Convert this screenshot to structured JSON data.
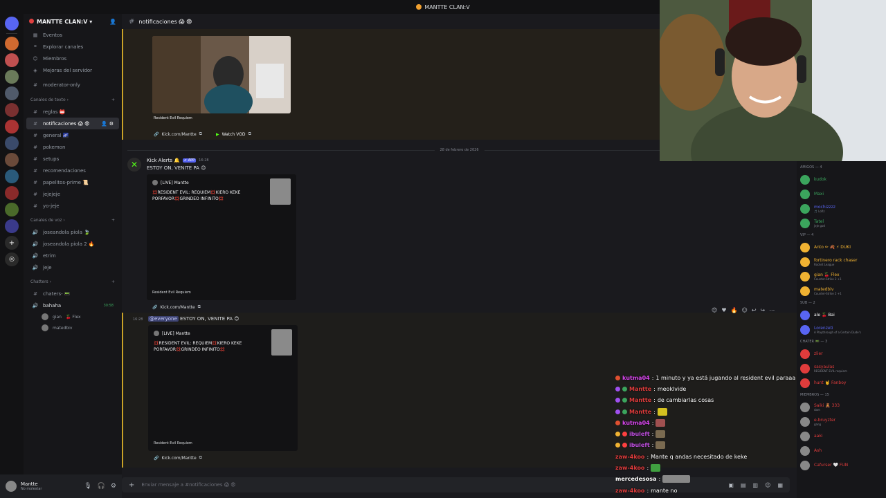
{
  "window": {
    "title": "MANTTE CLAN:V"
  },
  "server": {
    "name": "MANTTE CLAN:V"
  },
  "sidebar": {
    "top_items": [
      {
        "icon": "calendar-icon",
        "label": "Eventos"
      },
      {
        "icon": "compass-icon",
        "label": "Explorar canales"
      },
      {
        "icon": "members-icon",
        "label": "Miembros"
      },
      {
        "icon": "boost-icon",
        "label": "Mejoras del servidor"
      }
    ],
    "moderator_channel": "moderator-only",
    "text_category": "Canales de texto",
    "text_channels": [
      "reglas 📛",
      "notificaciones 😱 😨",
      "general 🌌",
      "pokemon",
      "setups",
      "recomendaciones",
      "papelitos-prime 📜",
      "jejejeje",
      "yo-jeje"
    ],
    "voice_category": "Canales de voz",
    "voice_channels": [
      "joseandola piola 🍃",
      "joseandola piola 2 🔥",
      "etrim",
      "jeje"
    ],
    "chatters_category": "Chatters",
    "chatters_channel": "chaters- 📟",
    "bahaha_channel": "bahaha",
    "bahaha_time": "30:58",
    "voice_users": [
      {
        "name": "gian",
        "tag": "🍒 Flex"
      },
      {
        "name": "matedbiv",
        "tag": ""
      }
    ]
  },
  "user_panel": {
    "name": "Mantte",
    "status": "No molestar"
  },
  "channel_header": {
    "name": "notificaciones 😱 😨"
  },
  "messages": {
    "top_embed_footer": "Resident Evil Requiem",
    "top_link": "Kick.com/Mantte",
    "watch_vod": "Watch VOD",
    "date_divider": "28 de febrero de 2026",
    "bot_name": "Kick Alerts 🔔",
    "app_badge": "✔ APP",
    "bot_time": "16:28",
    "msg1_text": "ESTOY ON, VENITE PA 😊",
    "embed_title": "[LIVE] Mantte",
    "embed_desc": "💢RESIDENT EVIL: REQUIEM💢KIERO KEKE PORFAVOR💢GRINDEO INFINITO💢",
    "embed_footer": "Resident Evil Requiem",
    "link_label": "Kick.com/Mantte",
    "msg2_time": "16:28",
    "mention": "@everyone",
    "msg2_text": " ESTOY ON, VENITE PA 😊"
  },
  "composer": {
    "placeholder": "Enviar mensaje a #notificaciones 😱 😨"
  },
  "members": {
    "cat_amigos": "AMIGOS — 4",
    "amigos": [
      {
        "name": "kudok",
        "activity": "",
        "color": "#3ba55d"
      },
      {
        "name": "Maxi",
        "activity": "",
        "color": "#3ba55d"
      },
      {
        "name": "mochizzzz",
        "activity": "🎵 Lofiz",
        "color": "#5865f2"
      },
      {
        "name": "Tatel",
        "activity": "jeje god",
        "color": "#3ba55d"
      }
    ],
    "cat_vip": "VIP — 4",
    "vip": [
      {
        "name": "Anto ✏ 🍂 ⚡ DUKI",
        "activity": "",
        "color": "#f0b232"
      },
      {
        "name": "fortinero rack chaser",
        "activity": "Rocket League",
        "color": "#f0b232"
      },
      {
        "name": "gian 🍒 Flex",
        "activity": "Counter-Strike 2 +1",
        "color": "#f0b232"
      },
      {
        "name": "matedbiv",
        "activity": "Counter-Strike 2 +1",
        "color": "#f0b232"
      }
    ],
    "cat_sub": "SUB — 2",
    "sub": [
      {
        "name": "ale 🍒 Bai",
        "activity": "",
        "color": "#ffffff"
      },
      {
        "name": "Lorenzeti",
        "activity": "A Playthrough of a Certain Dude's",
        "color": "#5865f2"
      }
    ],
    "cat_chater": "CHATER 📟 — 3",
    "chater": [
      {
        "name": "zlier",
        "activity": "",
        "color": "#e03c3c"
      },
      {
        "name": "sasyaulas",
        "activity": "RESIDENT EVIL requiem",
        "color": "#e03c3c"
      },
      {
        "name": "hunt 🤘 Fanboy",
        "activity": "",
        "color": "#e03c3c"
      }
    ],
    "cat_miembros": "MIEMBROS — 15",
    "miembros": [
      {
        "name": "Saiki 🧸 333",
        "activity": "dam",
        "color": "#e03c3c"
      },
      {
        "name": "e-bruyzter",
        "activity": "gang",
        "color": "#e03c3c"
      },
      {
        "name": "aaki",
        "activity": "",
        "color": "#e03c3c"
      },
      {
        "name": "Ash",
        "activity": "",
        "color": "#e03c3c"
      },
      {
        "name": "Cafurser 🤍 FUN",
        "activity": "",
        "color": "#e03c3c"
      }
    ]
  },
  "chat_overlay": [
    {
      "user": "kutma04",
      "user_color": "#d946ef",
      "text": "1 minuto y ya está jugando al resident evil paraaa",
      "badges": [
        "#e05030"
      ],
      "emote": ""
    },
    {
      "user": "Mantte",
      "user_color": "#e03c3c",
      "text": "meoklvide",
      "badges": [
        "#a050f0",
        "#3ba55d"
      ],
      "emote": ""
    },
    {
      "user": "Mantte",
      "user_color": "#e03c3c",
      "text": "de cambiarlas cosas",
      "badges": [
        "#a050f0",
        "#3ba55d"
      ],
      "emote": ""
    },
    {
      "user": "Mantte",
      "user_color": "#e03c3c",
      "text": "",
      "badges": [
        "#a050f0",
        "#3ba55d"
      ],
      "emote": "#d4c020"
    },
    {
      "user": "kutma04",
      "user_color": "#d946ef",
      "text": "",
      "badges": [
        "#e05030"
      ],
      "emote": "#a05050"
    },
    {
      "user": "ibuleft",
      "user_color": "#c04fe0",
      "text": "",
      "badges": [
        "#f0b232",
        "#ff4040"
      ],
      "emote": "#7a6a50"
    },
    {
      "user": "ibuleft",
      "user_color": "#c04fe0",
      "text": "",
      "badges": [
        "#f0b232",
        "#ff4040"
      ],
      "emote": "#7a6a50"
    },
    {
      "user": "zaw-4koo",
      "user_color": "#e03c3c",
      "text": "Mante q andas necesitado de keke",
      "badges": [],
      "emote": ""
    },
    {
      "user": "zaw-4koo",
      "user_color": "#e03c3c",
      "text": "",
      "badges": [],
      "emote": "#40a040"
    },
    {
      "user": "mercedesosa",
      "user_color": "#ffffff",
      "text": "",
      "badges": [],
      "emote": "#888888"
    },
    {
      "user": "zaw-4koo",
      "user_color": "#e03c3c",
      "text": "mante no",
      "badges": [],
      "emote": ""
    }
  ]
}
